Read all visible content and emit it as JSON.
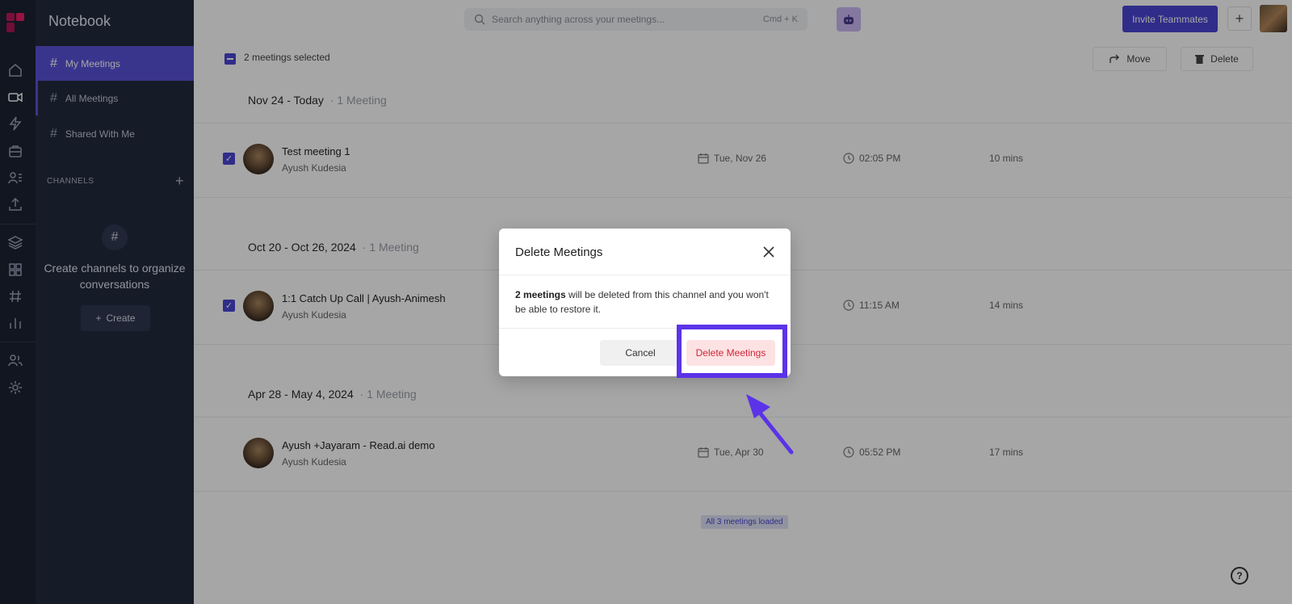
{
  "sidebar": {
    "title": "Notebook",
    "items": [
      {
        "label": "My Meetings"
      },
      {
        "label": "All Meetings"
      },
      {
        "label": "Shared With Me"
      }
    ],
    "channels_label": "CHANNELS",
    "empty_text": "Create channels to organize conversations",
    "create_label": "Create"
  },
  "rail": {
    "icons": [
      "home-icon",
      "video-icon",
      "bolt-icon",
      "briefcase-icon",
      "user-list-icon",
      "upload-icon",
      "layers-icon",
      "grid-icon",
      "hash-icon",
      "bar-chart-icon",
      "users-icon",
      "gear-icon"
    ]
  },
  "topbar": {
    "search_placeholder": "Search anything across your meetings...",
    "shortcut": "Cmd + K",
    "invite_label": "Invite Teammates"
  },
  "selection": {
    "text": "2 meetings selected",
    "move_label": "Move",
    "delete_label": "Delete"
  },
  "groups": [
    {
      "heading": "Nov 24 - Today",
      "count": "1 Meeting",
      "meeting": {
        "title": "Test meeting 1",
        "owner": "Ayush Kudesia",
        "date": "Tue, Nov 26",
        "time": "02:05 PM",
        "duration": "10 mins",
        "checked": true
      }
    },
    {
      "heading": "Oct 20 - Oct 26, 2024",
      "count": "1 Meeting",
      "meeting": {
        "title": "1:1 Catch Up Call | Ayush-Animesh",
        "owner": "Ayush Kudesia",
        "date": "",
        "time": "11:15 AM",
        "duration": "14 mins",
        "checked": true
      }
    },
    {
      "heading": "Apr 28 - May 4, 2024",
      "count": "1 Meeting",
      "meeting": {
        "title": "Ayush +Jayaram - Read.ai demo",
        "owner": "Ayush Kudesia",
        "date": "Tue, Apr 30",
        "time": "05:52 PM",
        "duration": "17 mins",
        "checked": false
      }
    }
  ],
  "loaded_text": "All 3 meetings loaded",
  "dialog": {
    "title": "Delete Meetings",
    "body_bold": "2 meetings",
    "body_rest": " will be deleted from this channel and you won't be able to restore it.",
    "cancel_label": "Cancel",
    "confirm_label": "Delete Meetings"
  },
  "colors": {
    "accent": "#4b45d4",
    "highlight": "#5b33e8",
    "danger_text": "#d02738",
    "sidebar_bg": "#222a3e"
  }
}
